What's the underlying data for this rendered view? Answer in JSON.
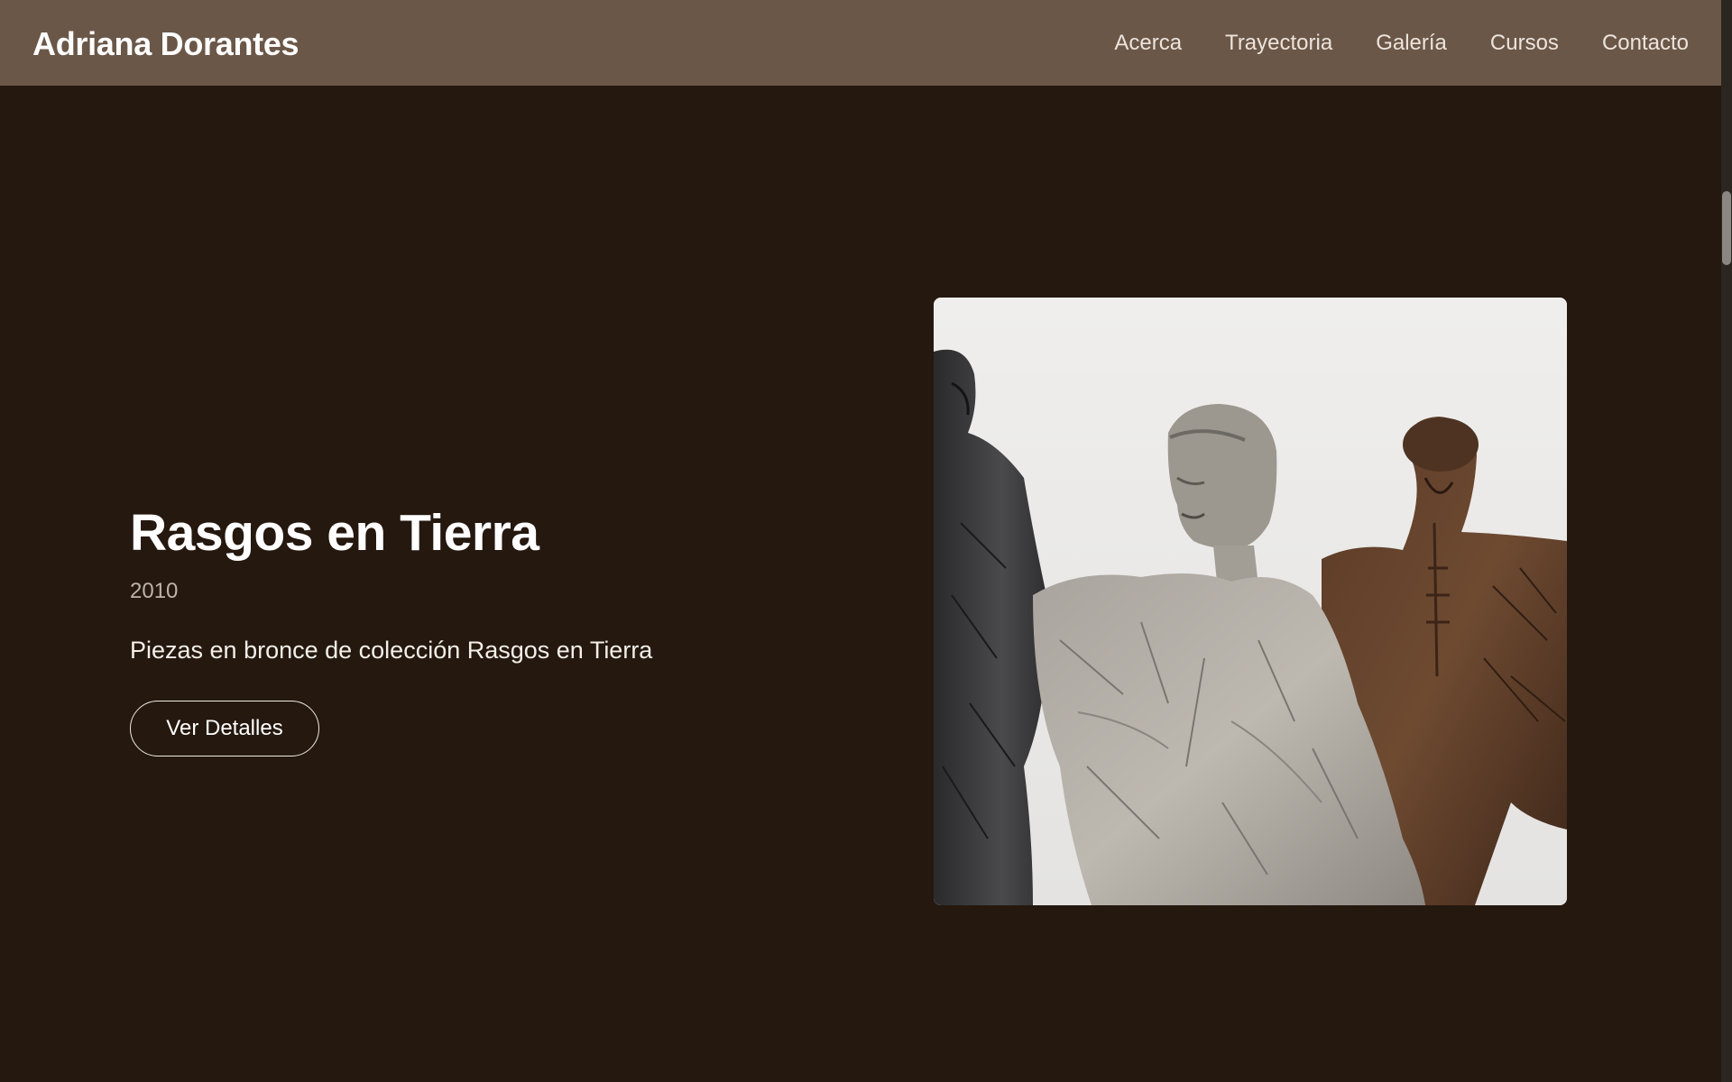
{
  "header": {
    "brand": "Adriana Dorantes",
    "nav": [
      {
        "label": "Acerca"
      },
      {
        "label": "Trayectoria"
      },
      {
        "label": "Galería"
      },
      {
        "label": "Cursos"
      },
      {
        "label": "Contacto"
      }
    ]
  },
  "hero": {
    "title": "Rasgos en Tierra",
    "year": "2010",
    "description": "Piezas en bronce de colección Rasgos en Tierra",
    "button_label": "Ver Detalles"
  },
  "colors": {
    "background": "#24180f",
    "navbar": "#6b5748",
    "text": "#ffffff"
  }
}
